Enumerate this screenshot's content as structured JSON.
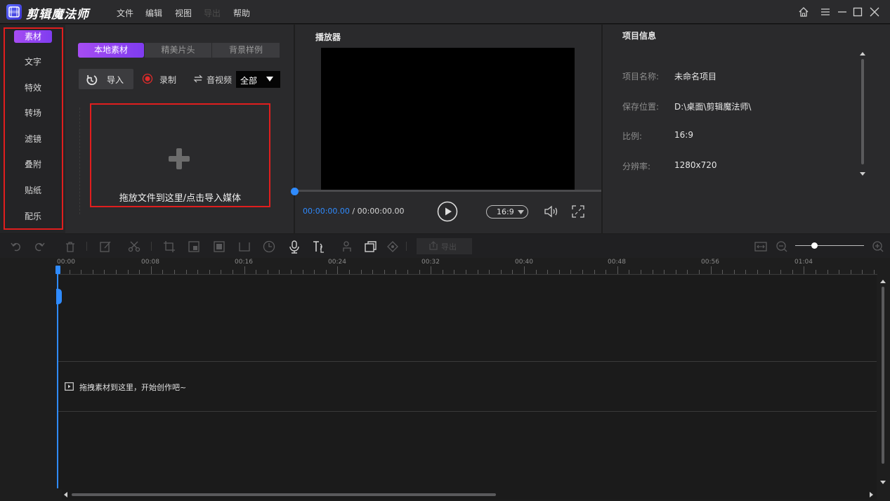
{
  "app": {
    "name": "剪辑魔法师",
    "menu": [
      "文件",
      "编辑",
      "视图",
      "导出",
      "帮助"
    ]
  },
  "categories": [
    "素材",
    "文字",
    "特效",
    "转场",
    "滤镜",
    "叠附",
    "贴纸",
    "配乐"
  ],
  "media": {
    "tabs": [
      "本地素材",
      "精美片头",
      "背景样例"
    ],
    "import_label": "导入",
    "record_label": "录制",
    "audio_video_label": "音视频",
    "filter_value": "全部",
    "drop_hint": "拖放文件到这里/点击导入媒体"
  },
  "player": {
    "title": "播放器",
    "current_time": "00:00:00.00",
    "separator": " / ",
    "total_time": "00:00:00.00",
    "aspect_ratio": "16:9"
  },
  "project_info": {
    "title": "项目信息",
    "rows": [
      {
        "label": "项目名称:",
        "value": "未命名项目"
      },
      {
        "label": "保存位置:",
        "value": "D:\\桌面\\剪辑魔法师\\"
      },
      {
        "label": "比例:",
        "value": "16:9"
      },
      {
        "label": "分辨率:",
        "value": "1280x720"
      }
    ]
  },
  "timeline": {
    "export_label": "导出",
    "ticks": [
      "00:00",
      "00:08",
      "00:16",
      "00:24",
      "00:32",
      "00:40",
      "00:48",
      "00:56",
      "01:04"
    ],
    "drop_hint": "拖拽素材到这里，开始创作吧~"
  },
  "colors": {
    "accent": "#8f45f3",
    "highlight_box": "#e01e1e",
    "playhead": "#2f8bff"
  }
}
